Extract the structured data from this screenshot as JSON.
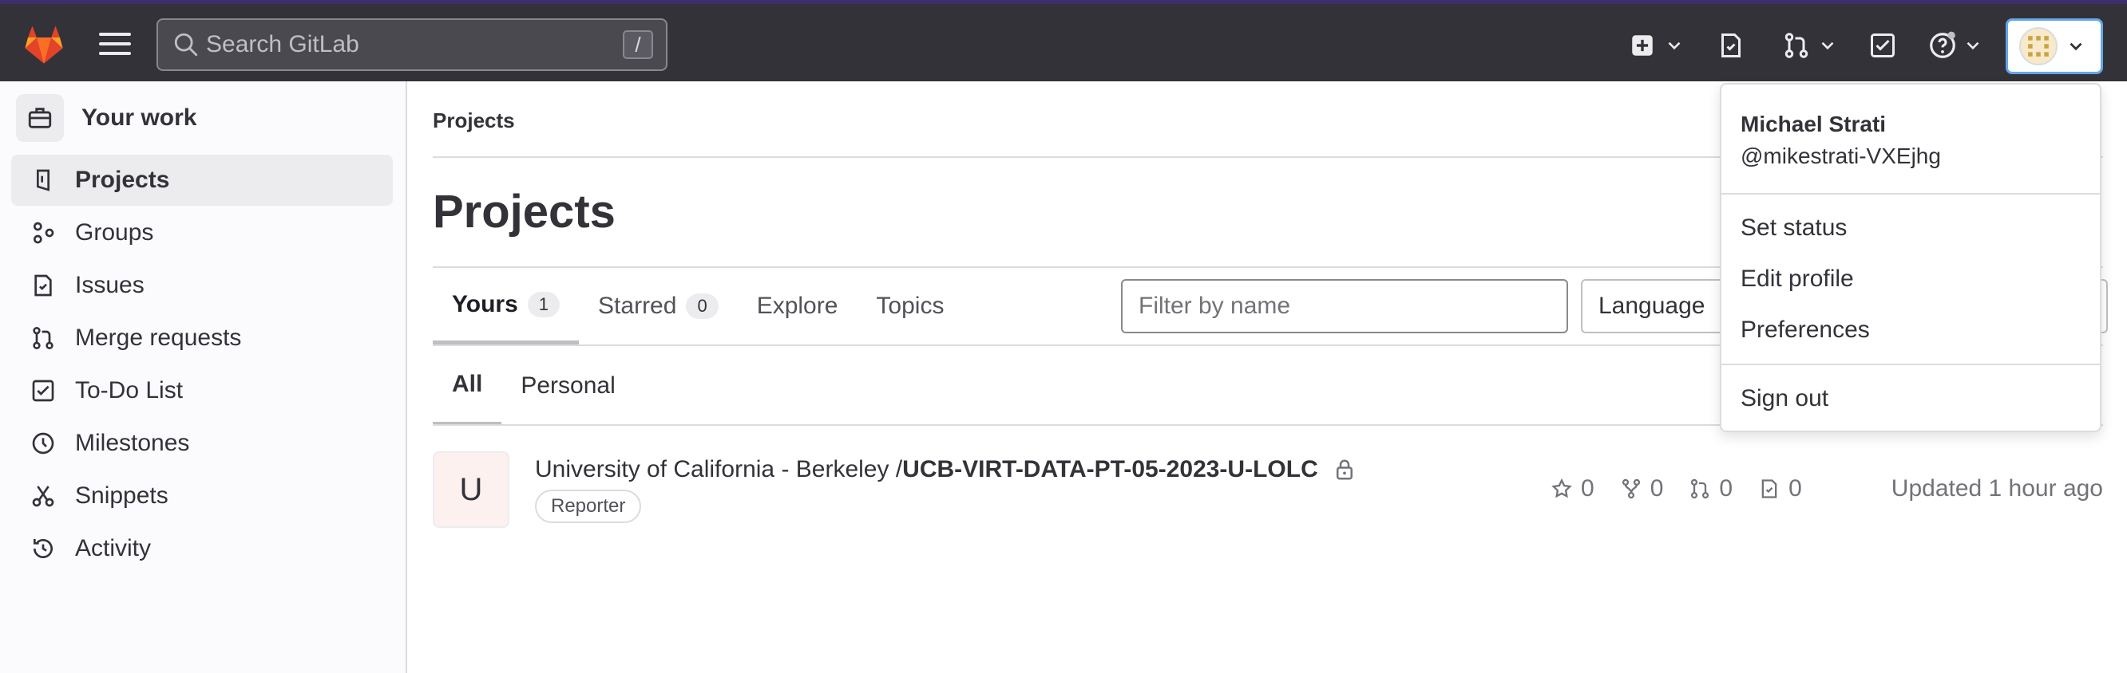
{
  "topbar": {
    "search_placeholder": "Search GitLab",
    "search_shortcut": "/"
  },
  "sidebar": {
    "context_label": "Your work",
    "items": [
      {
        "label": "Projects",
        "icon": "project-icon",
        "active": true
      },
      {
        "label": "Groups",
        "icon": "group-icon"
      },
      {
        "label": "Issues",
        "icon": "issues-icon"
      },
      {
        "label": "Merge requests",
        "icon": "merge-request-icon"
      },
      {
        "label": "To-Do List",
        "icon": "todo-icon"
      },
      {
        "label": "Milestones",
        "icon": "milestone-icon"
      },
      {
        "label": "Snippets",
        "icon": "snippet-icon"
      },
      {
        "label": "Activity",
        "icon": "history-icon"
      }
    ]
  },
  "main": {
    "breadcrumb": "Projects",
    "title": "Projects",
    "tabs": [
      {
        "label": "Yours",
        "count": "1",
        "active": true
      },
      {
        "label": "Starred",
        "count": "0"
      },
      {
        "label": "Explore"
      },
      {
        "label": "Topics"
      }
    ],
    "filter_placeholder": "Filter by name",
    "language_label": "Language",
    "subtabs": [
      {
        "label": "All",
        "active": true
      },
      {
        "label": "Personal"
      }
    ],
    "project": {
      "avatar_letter": "U",
      "namespace": "University of California - Berkeley / ",
      "name": "UCB-VIRT-DATA-PT-05-2023-U-LOLC",
      "role": "Reporter",
      "stars": "0",
      "forks": "0",
      "merge_requests": "0",
      "issues": "0",
      "updated": "Updated 1 hour ago"
    }
  },
  "user_menu": {
    "name": "Michael Strati",
    "handle": "@mikestrati-VXEjhg",
    "set_status": "Set status",
    "edit_profile": "Edit profile",
    "preferences": "Preferences",
    "sign_out": "Sign out"
  },
  "colors": {
    "topbar": "#333238",
    "accent": "#63a6e9",
    "brand_orange": "#fc6d26"
  }
}
